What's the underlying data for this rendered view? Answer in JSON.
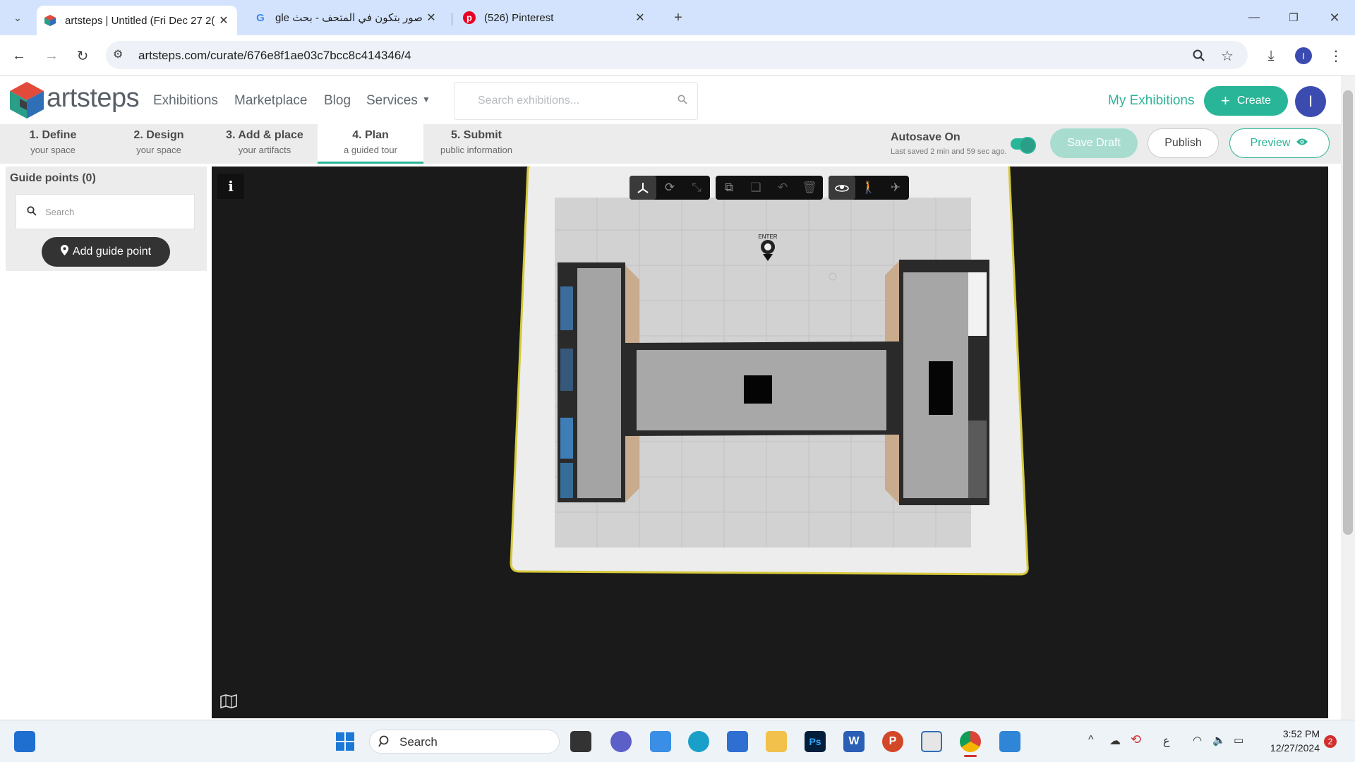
{
  "browser": {
    "tabs": [
      {
        "title": "artsteps | Untitled (Fri Dec 27 2(",
        "active": true
      },
      {
        "title": "صور بتكون في المتحف - بحث gle",
        "active": false
      },
      {
        "title": "(526) Pinterest",
        "active": false
      }
    ],
    "url": "artsteps.com/curate/676e8f1ae03c7bcc8c414346/4",
    "profile_initial": "I"
  },
  "site": {
    "logo": "artsteps",
    "nav": [
      "Exhibitions",
      "Marketplace",
      "Blog",
      "Services"
    ],
    "search_placeholder": "Search exhibitions...",
    "my_exhibitions": "My Exhibitions",
    "create_label": "Create",
    "avatar_initial": "I"
  },
  "steps": [
    {
      "num": "1. Define",
      "sub": "your space"
    },
    {
      "num": "2. Design",
      "sub": "your space"
    },
    {
      "num": "3. Add & place",
      "sub": "your artifacts"
    },
    {
      "num": "4. Plan",
      "sub": "a guided tour"
    },
    {
      "num": "5. Submit",
      "sub": "public information"
    }
  ],
  "active_step": 4,
  "autosave": {
    "label": "Autosave On",
    "last_saved": "Last saved 2 min and 59 sec ago.",
    "enabled": true
  },
  "actions": {
    "save_draft": "Save Draft",
    "publish": "Publish",
    "preview": "Preview"
  },
  "guide_panel": {
    "title": "Guide points (0)",
    "search_placeholder": "Search",
    "add_button": "Add guide point"
  },
  "canvas": {
    "info_icon": "i",
    "marker_label": "ENTER"
  },
  "taskbar": {
    "search_label": "Search",
    "time": "3:52 PM",
    "date": "12/27/2024",
    "notification_count": "2",
    "lang": "ع"
  },
  "colors": {
    "brand_teal": "#29b597",
    "avatar_blue": "#3c4bb0",
    "canvas_bg": "#1a1a1a",
    "floor_outline": "#d6c93a"
  }
}
